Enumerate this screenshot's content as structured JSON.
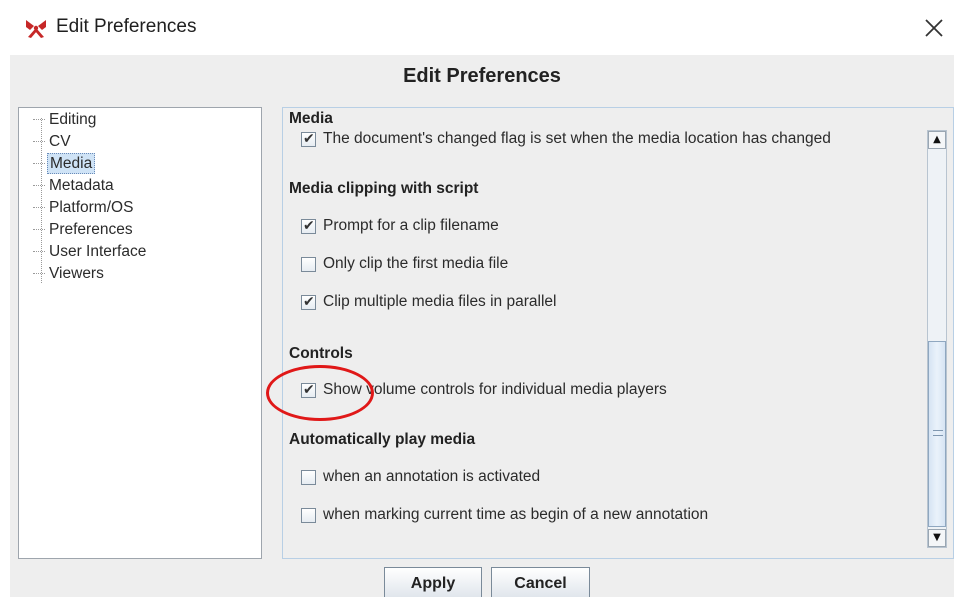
{
  "window": {
    "title": "Edit Preferences",
    "app_icon": "app-logo-icon",
    "close_icon": "close-icon"
  },
  "dialog": {
    "header": "Edit Preferences"
  },
  "tree": {
    "items": [
      {
        "label": "Editing",
        "selected": false
      },
      {
        "label": "CV",
        "selected": false
      },
      {
        "label": "Media",
        "selected": true
      },
      {
        "label": "Metadata",
        "selected": false
      },
      {
        "label": "Platform/OS",
        "selected": false
      },
      {
        "label": "Preferences",
        "selected": false
      },
      {
        "label": "User Interface",
        "selected": false
      },
      {
        "label": "Viewers",
        "selected": false
      }
    ]
  },
  "panel": {
    "title": "Media",
    "changed_flag": {
      "label": "The document's changed flag is set when the media location has changed",
      "checked": true
    },
    "clipping": {
      "title": "Media clipping with script",
      "options": [
        {
          "label": "Prompt for a clip filename",
          "checked": true
        },
        {
          "label": "Only clip the first media file",
          "checked": false
        },
        {
          "label": "Clip multiple media files in parallel",
          "checked": true
        }
      ]
    },
    "controls": {
      "title": "Controls",
      "options": [
        {
          "label": "Show volume controls for individual media players",
          "checked": true
        }
      ]
    },
    "autoplay": {
      "title": "Automatically play media",
      "options": [
        {
          "label": "when an annotation is activated",
          "checked": false
        },
        {
          "label": "when marking current time as begin of a new annotation",
          "checked": false
        }
      ]
    }
  },
  "buttons": {
    "apply": "Apply",
    "cancel": "Cancel"
  },
  "colors": {
    "annotation_circle": "#e01818",
    "selection": "#cfe3f6"
  }
}
